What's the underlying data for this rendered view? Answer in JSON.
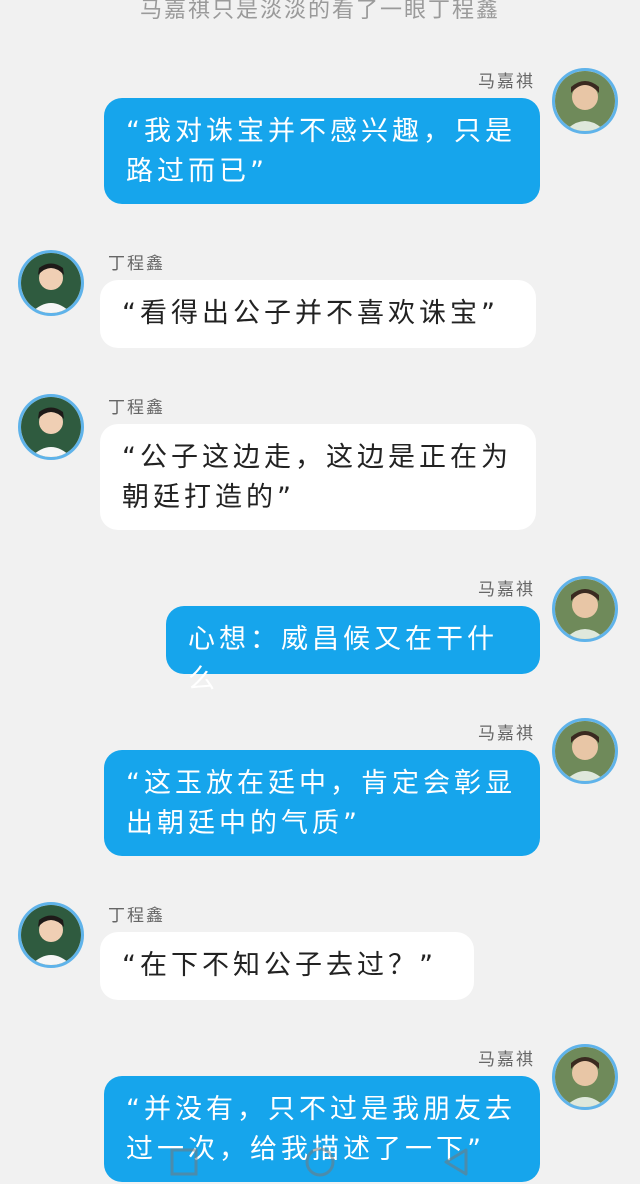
{
  "narration": "马嘉祺只是淡淡的看了一眼丁程鑫",
  "speakers": {
    "mjq": "马嘉祺",
    "dcx": "丁程鑫"
  },
  "messages": [
    {
      "speaker": "马嘉祺",
      "text": "“我对诛宝并不感兴趣，只是路过而已”"
    },
    {
      "speaker": "丁程鑫",
      "text": "“看得出公子并不喜欢诛宝”"
    },
    {
      "speaker": "丁程鑫",
      "text": "“公子这边走，这边是正在为朝廷打造的”"
    },
    {
      "speaker": "马嘉祺",
      "text": "心想：威昌候又在干什么"
    },
    {
      "speaker": "马嘉祺",
      "text": "“这玉放在廷中，肯定会彰显出朝廷中的气质”"
    },
    {
      "speaker": "丁程鑫",
      "text": "“在下不知公子去过？”"
    },
    {
      "speaker": "马嘉祺",
      "text": "“并没有，只不过是我朋友去过一次，给我描述了一下”"
    }
  ],
  "colors": {
    "background": "#f1f1f1",
    "right_bubble": "#16a5ec",
    "left_bubble": "#ffffff",
    "avatar_ring": "#5fb3ea"
  },
  "icons": {
    "back": "triangle-back-icon",
    "home": "circle-home-icon",
    "recent": "square-recent-icon"
  }
}
